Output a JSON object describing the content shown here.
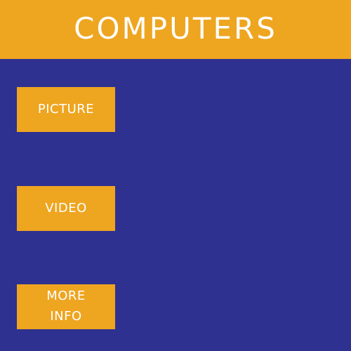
{
  "header": {
    "title": "COMPUTERS"
  },
  "menu": {
    "picture_label": "PICTURE",
    "video_label": "VIDEO",
    "more_info_label": "MORE\nINFO"
  },
  "colors": {
    "header_bg": "#eea520",
    "page_bg": "#2e3190",
    "button_bg": "#eea520",
    "text": "#ffffff"
  }
}
